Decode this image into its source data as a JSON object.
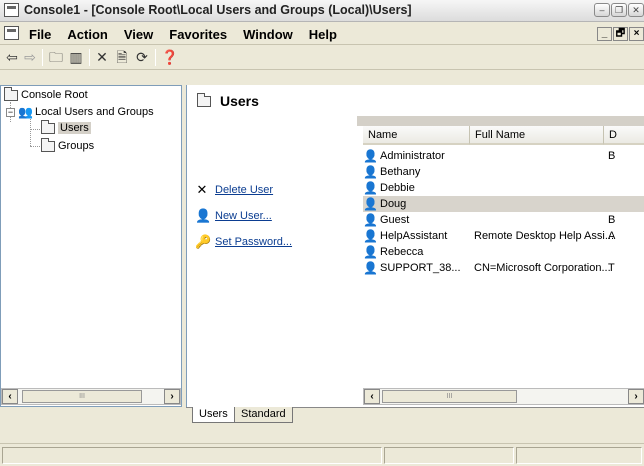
{
  "window": {
    "title": "Console1 - [Console Root\\Local Users and Groups (Local)\\Users]"
  },
  "menu": {
    "items": [
      "File",
      "Action",
      "View",
      "Favorites",
      "Window",
      "Help"
    ]
  },
  "toolbar": {
    "buttons": [
      "back-icon",
      "forward-icon",
      "up-level-icon",
      "show-hide-tree-icon",
      "delete-icon",
      "properties-icon",
      "refresh-icon",
      "help-icon"
    ]
  },
  "tree": {
    "root": "Console Root",
    "group": "Local Users and Groups",
    "children": [
      "Users",
      "Groups"
    ],
    "selected": "Users"
  },
  "pane": {
    "title": "Users"
  },
  "tasks": [
    "Delete User",
    "New User...",
    "Set Password..."
  ],
  "list": {
    "columns": [
      "Name",
      "Full Name",
      "D"
    ],
    "rows": [
      {
        "name": "Administrator",
        "full_name": "",
        "desc": "B"
      },
      {
        "name": "Bethany",
        "full_name": "",
        "desc": ""
      },
      {
        "name": "Debbie",
        "full_name": "",
        "desc": ""
      },
      {
        "name": "Doug",
        "full_name": "",
        "desc": "",
        "selected": true,
        "disabled": true
      },
      {
        "name": "Guest",
        "full_name": "",
        "desc": "B"
      },
      {
        "name": "HelpAssistant",
        "full_name": "Remote Desktop Help Assi...",
        "desc": "A"
      },
      {
        "name": "Rebecca",
        "full_name": "",
        "desc": ""
      },
      {
        "name": "SUPPORT_38...",
        "full_name": "CN=Microsoft Corporation...",
        "desc": "T"
      }
    ]
  },
  "tabs": [
    "Users",
    "Standard"
  ],
  "scroll_thumb_label": "III"
}
